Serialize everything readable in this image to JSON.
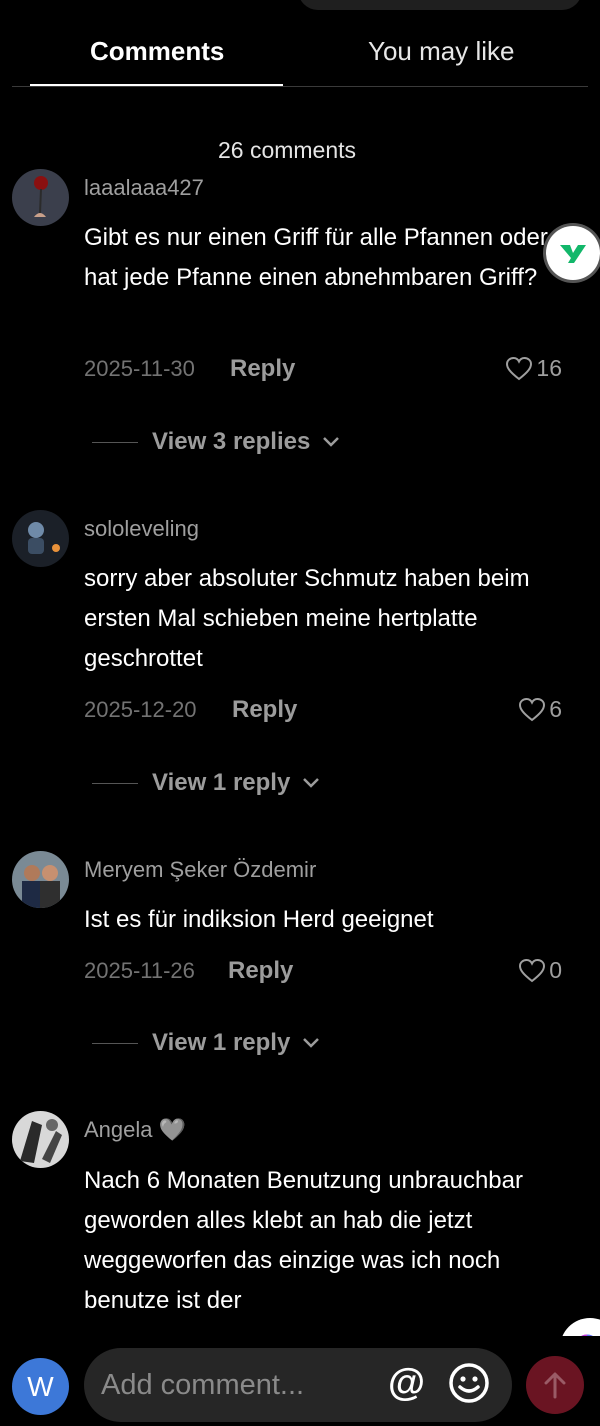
{
  "tabs": {
    "comments": "Comments",
    "you_may_like": "You may like"
  },
  "comment_count": "26 comments",
  "comments": [
    {
      "username": "laaalaaa427",
      "text": "Gibt es nur einen Griff für alle Pfannen oder hat jede Pfanne einen abnehmbaren Griff?",
      "date": "2025-11-30",
      "reply": "Reply",
      "likes": "16",
      "view_replies": "View 3 replies"
    },
    {
      "username": "sololeveling",
      "text": "sorry aber absoluter Schmutz haben beim ersten Mal schieben meine hertplatte geschrottet",
      "date": "2025-12-20",
      "reply": "Reply",
      "likes": "6",
      "view_replies": "View 1 reply"
    },
    {
      "username": "Meryem Şeker Özdemir",
      "text": "Ist es für indiksion Herd geeignet",
      "date": "2025-11-26",
      "reply": "Reply",
      "likes": "0",
      "view_replies": "View 1 reply"
    },
    {
      "username": "Angela 🩶",
      "text": "Nach 6 Monaten Benutzung unbrauchbar geworden alles klebt an hab die jetzt weggeworfen das einzige was ich noch benutze ist der"
    }
  ],
  "composer": {
    "avatar_letter": "W",
    "placeholder": "Add comment...",
    "at_symbol": "@"
  },
  "colors": {
    "background": "#000000",
    "username": "#9f9f9f",
    "date": "#737373",
    "avatar_w": "#3d78d8",
    "send_button": "#6a1422"
  },
  "icons": [
    "heart-outline-icon",
    "chevron-down-icon",
    "at-icon",
    "emoji-icon",
    "send-arrow-icon"
  ]
}
